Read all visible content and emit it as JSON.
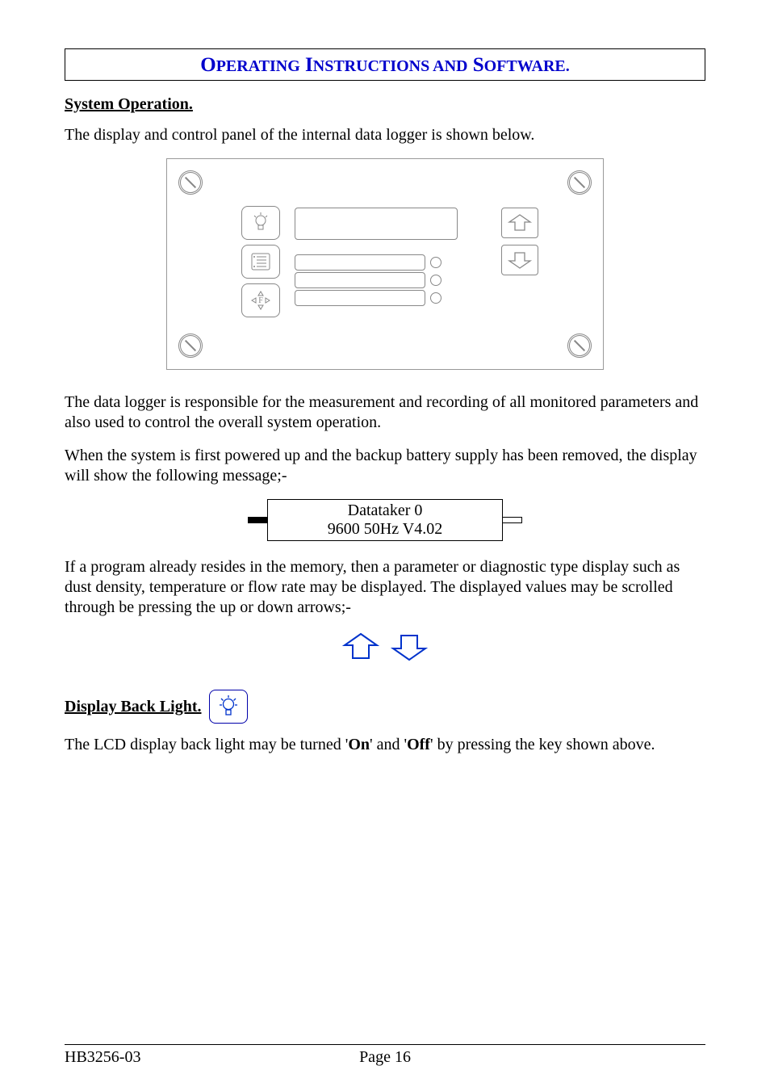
{
  "title": {
    "w1a": "O",
    "w1b": "PERATING",
    "w2a": "I",
    "w2b": "NSTRUCTIONS AND",
    "w3a": "S",
    "w3b": "OFTWARE."
  },
  "headings": {
    "system_operation": "System Operation.",
    "display_back_light": "Display Back Light."
  },
  "paragraphs": {
    "p1": "The display and control panel of the internal data logger is shown below.",
    "p2": "The data logger is responsible for the measurement and recording of all monitored parameters and also used to control the overall system operation.",
    "p3": "When the system is first powered up and the backup battery supply has been removed, the display will show the following message;-",
    "p4": "If a program already resides in the memory, then a parameter or diagnostic type display such as dust density, temperature or flow rate may be displayed. The displayed values may be scrolled through be pressing the up or down arrows;-",
    "p5_prefix": "The LCD display back light may be turned '",
    "p5_on": "On",
    "p5_mid": "' and '",
    "p5_off": "Off",
    "p5_suffix": "' by pressing the key shown above."
  },
  "lcd": {
    "line1": "Datataker 0",
    "line2": "9600 50Hz V4.02"
  },
  "panel_buttons": {
    "func_label": "F"
  },
  "footer": {
    "left": "HB3256-03",
    "center_prefix": "Page ",
    "center_number": "16"
  }
}
